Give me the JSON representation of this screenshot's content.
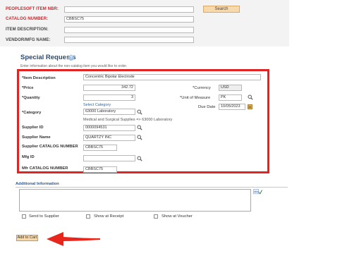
{
  "search_section": {
    "peoplesoft_item_label": "PEOPLESOFT ITEM NBR:",
    "peoplesoft_item_value": "",
    "catalog_number_label": "CATALOG NUMBER:",
    "catalog_number_value": "CBBSC75",
    "item_description_label": "ITEM DESCRIPTION:",
    "item_description_value": "",
    "vendor_mfg_label": "VENDOR/MFG NAME:",
    "vendor_mfg_value": "",
    "search_button": "Search"
  },
  "special_requests": {
    "title": "Special Requests",
    "help_icon": "help-icon",
    "description": "Enter information about the non-catalog item you would like to order.",
    "item_description_label": "*Item Description",
    "item_description_value": "Concentric Bipolar Electrode",
    "price_label": "*Price",
    "price_value": "342.72",
    "currency_label": "*Currency",
    "currency_value": "USD",
    "quantity_label": "*Quantity",
    "quantity_value": "3",
    "uom_label": "*Unit of Measure",
    "uom_value": "PK",
    "select_category_link": "Select Category",
    "due_date_label": "Due Date",
    "due_date_value": "10/05/2023",
    "category_label": "*Category",
    "category_value": "63000 Laboratory",
    "category_description": "Medical and Surgical Supplies => 63000 Laboratory",
    "supplier_id_label": "Supplier ID",
    "supplier_id_value": "0000094531",
    "supplier_name_label": "Supplier Name",
    "supplier_name_value": "QUARTZY INC",
    "supplier_catalog_label": "Supplier CATALOG NUMBER",
    "supplier_catalog_value": "CBBSC75",
    "mfg_id_label": "Mfg ID",
    "mfg_id_value": "",
    "mfr_catalog_label": "Mfr CATALOG NUMBER",
    "mfr_catalog_value": "CBBSC75"
  },
  "additional_info": {
    "title": "Additional Information",
    "text_value": "",
    "send_to_supplier": "Send to Supplier",
    "show_at_receipt": "Show at Receipt",
    "show_at_voucher": "Show at Voucher"
  },
  "add_to_cart_button": "Add to Cart",
  "colors": {
    "highlight_box": "#e02323",
    "required_label": "#c8262c",
    "title_blue": "#2b4a70",
    "button_fill": "#f7d9ac"
  },
  "icons": [
    "lookup-icon",
    "calendar-icon",
    "spell-check-icon",
    "help-icon",
    "arrow-icon"
  ]
}
